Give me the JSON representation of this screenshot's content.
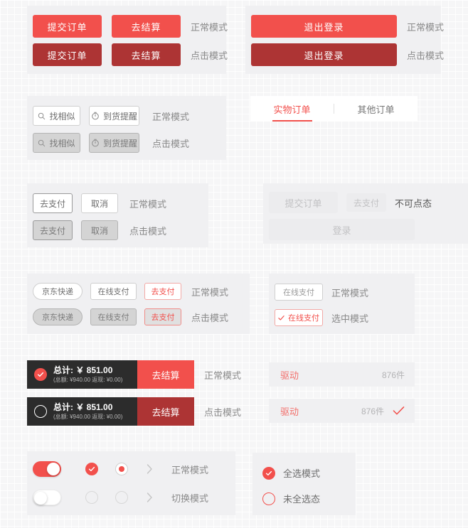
{
  "sections": {
    "primary_buttons": {
      "normal_label": "正常模式",
      "pressed_label": "点击模式",
      "submit_order": "提交订单",
      "go_checkout": "去结算"
    },
    "logout_buttons": {
      "normal_label": "正常模式",
      "pressed_label": "点击模式",
      "logout": "退出登录"
    },
    "icon_buttons": {
      "normal_label": "正常模式",
      "pressed_label": "点击模式",
      "find_similar": "找相似",
      "arrival_reminder": "到货提醒",
      "find_similar_icon": "search-icon",
      "arrival_reminder_icon": "clock-icon"
    },
    "tabs": {
      "items": [
        {
          "label": "实物订单",
          "active": true
        },
        {
          "label": "其他订单",
          "active": false
        }
      ]
    },
    "ghost_buttons": {
      "normal_label": "正常模式",
      "pressed_label": "点击模式",
      "pay": "去支付",
      "cancel": "取消"
    },
    "disabled_buttons": {
      "state_label": "不可点态",
      "submit_order": "提交订单",
      "pay": "去支付",
      "login": "登录"
    },
    "tag_buttons": {
      "normal_label": "正常模式",
      "pressed_label": "点击模式",
      "express": "京东快递",
      "online_pay": "在线支付",
      "pay": "去支付"
    },
    "select_buttons": {
      "normal_label": "正常模式",
      "selected_label": "选中模式",
      "online_pay": "在线支付",
      "check_icon": "check-icon"
    },
    "checkout_bar": {
      "normal_label": "正常模式",
      "pressed_label": "点击模式",
      "total": "总计: ￥ 851.00",
      "sub": "(总额: ¥940.00  返现: ¥0.00)",
      "button": "去结算",
      "checked_icon": "check-circle-filled-icon",
      "unchecked_icon": "circle-outline-icon"
    },
    "list_rows": {
      "rows": [
        {
          "name": "驱动",
          "count": "876件",
          "selected": false
        },
        {
          "name": "驱动",
          "count": "876件",
          "selected": true
        }
      ],
      "check_icon": "check-icon"
    },
    "controls": {
      "normal_label": "正常模式",
      "toggled_label": "切换模式",
      "switch_on_icon": "toggle-on-icon",
      "switch_off_icon": "toggle-off-icon",
      "checkbox_on_icon": "checkbox-checked-icon",
      "checkbox_off_icon": "checkbox-unchecked-icon",
      "radio_on_icon": "radio-selected-icon",
      "radio_off_icon": "radio-unselected-icon",
      "chevron_icon": "chevron-right-icon"
    },
    "select_all": {
      "items": [
        {
          "label": "全选模式",
          "selected": true
        },
        {
          "label": "未全选态",
          "selected": false
        }
      ],
      "on_icon": "check-circle-filled-icon",
      "off_icon": "circle-outline-red-icon"
    }
  },
  "colors": {
    "brand_red": "#f2504c",
    "pressed_red": "#ad3434",
    "dark_bar": "#2c2c2c",
    "panel_bg": "#f0f0f2",
    "page_bg": "#f6f6f7"
  }
}
